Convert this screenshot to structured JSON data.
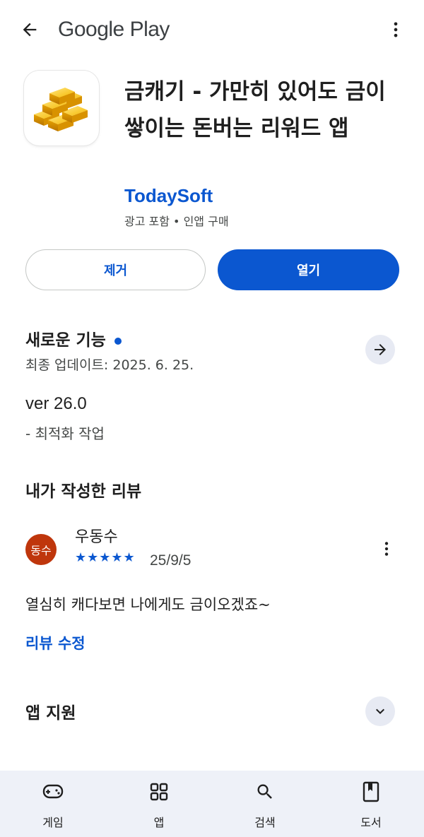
{
  "header": {
    "brand": "Google Play",
    "back_icon": "arrow-back-icon",
    "more_icon": "more-vert-icon"
  },
  "app": {
    "title": "금캐기 - 가만히 있어도 금이 쌓이는 돈버는 리워드 앱",
    "developer": "TodaySoft",
    "meta": "광고 포함 • 인앱 구매",
    "icon": "gold-bars-icon"
  },
  "actions": {
    "uninstall": "제거",
    "open": "열기"
  },
  "whats_new": {
    "title": "새로운 기능",
    "updated": "최종 업데이트: 2025. 6. 25.",
    "version": "ver 26.0",
    "notes": "- 최적화 작업"
  },
  "my_review": {
    "title": "내가 작성한 리뷰",
    "avatar_text": "동수",
    "reviewer": "우동수",
    "stars": "★★★★★",
    "rating": 5,
    "date": "25/9/5",
    "text": "열심히 캐다보면 나에게도 금이오겠죠~",
    "edit": "리뷰 수정"
  },
  "app_support": {
    "title": "앱 지원"
  },
  "bottom_nav": {
    "items": [
      {
        "label": "게임",
        "icon": "gamepad-icon"
      },
      {
        "label": "앱",
        "icon": "apps-grid-icon"
      },
      {
        "label": "검색",
        "icon": "search-icon"
      },
      {
        "label": "도서",
        "icon": "book-icon"
      }
    ]
  },
  "colors": {
    "accent": "#0b57d0",
    "avatar": "#bf360c",
    "nav_bg": "#eef1f8"
  }
}
